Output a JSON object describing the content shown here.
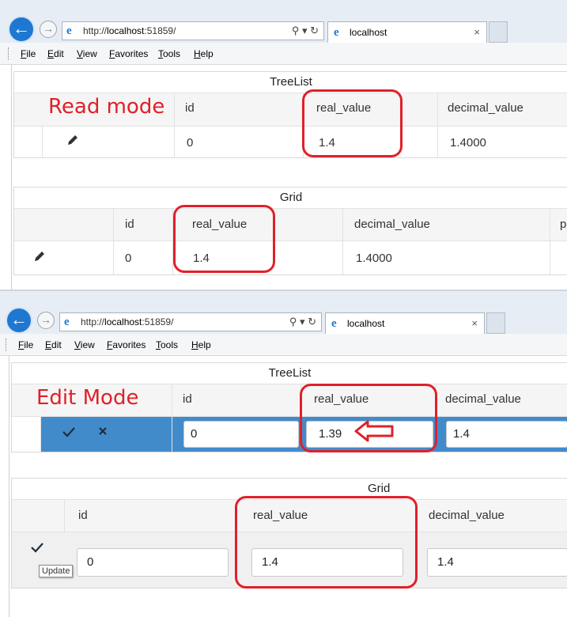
{
  "browser": {
    "url_prefix": "http://",
    "url_host": "localhost",
    "url_port": ":51859/",
    "tab_title": "localhost",
    "address_tools": "⚲ ▾ ↻",
    "tab_close": "×",
    "back_glyph": "←",
    "forward_glyph": "→",
    "ie_glyph": "e"
  },
  "menu": [
    "File",
    "Edit",
    "View",
    "Favorites",
    "Tools",
    "Help"
  ],
  "columns": {
    "id": "id",
    "real_value": "real_value",
    "decimal_value": "decimal_value",
    "extra_cut": "p"
  },
  "read_mode": {
    "annotation": "Read mode",
    "treelist": {
      "title": "TreeList",
      "row": {
        "id": "0",
        "real_value": "1.4",
        "decimal_value": "1.4000"
      }
    },
    "grid": {
      "title": "Grid",
      "row": {
        "id": "0",
        "real_value": "1.4",
        "decimal_value": "1.4000"
      }
    }
  },
  "edit_mode": {
    "annotation": "Edit Mode",
    "treelist": {
      "title": "TreeList",
      "inputs": {
        "id": "0",
        "real_value": "1.39",
        "decimal_value": "1.4"
      }
    },
    "grid": {
      "title": "Grid",
      "inputs": {
        "id": "0",
        "real_value": "1.4",
        "decimal_value": "1.4"
      },
      "tooltip": "Update"
    }
  },
  "icons": {
    "edit": "pencil-icon",
    "update": "check-icon",
    "cancel": "close-icon"
  },
  "colors": {
    "annotation_red": "#e0202a",
    "edit_row_blue": "#428bca",
    "browser_blue": "#1e78d2"
  }
}
